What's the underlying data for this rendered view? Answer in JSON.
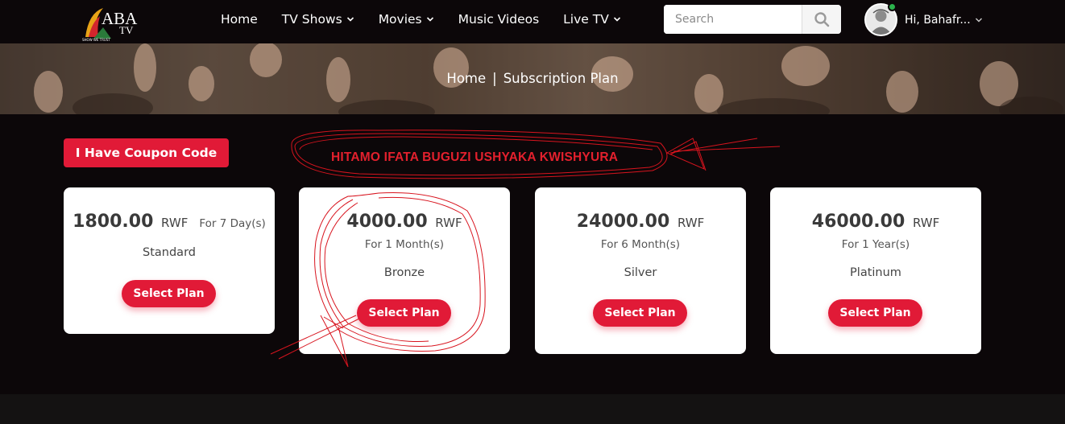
{
  "header": {
    "logo": {
      "wordmark": "ABA",
      "sub": "TV",
      "tagline": "SHOW WE TRUST"
    },
    "nav": [
      {
        "label": "Home",
        "dropdown": false
      },
      {
        "label": "TV Shows",
        "dropdown": true
      },
      {
        "label": "Movies",
        "dropdown": true
      },
      {
        "label": "Music Videos",
        "dropdown": false
      },
      {
        "label": "Live TV",
        "dropdown": true
      }
    ],
    "search": {
      "placeholder": "Search",
      "value": ""
    },
    "user": {
      "greeting": "Hi, Bahafr..."
    }
  },
  "banner": {
    "breadcrumb": {
      "home": "Home",
      "separator": "|",
      "current": "Subscription Plan"
    }
  },
  "main": {
    "coupon_label": "I Have Coupon Code",
    "annotation": "HITAMO IFATA BUGUZI USHYAKA KWISHYURA",
    "plans": [
      {
        "price": "1800.00",
        "currency": "RWF",
        "duration": "For 7 Day(s)",
        "tier": "Standard",
        "button": "Select Plan"
      },
      {
        "price": "4000.00",
        "currency": "RWF",
        "duration": "For 1 Month(s)",
        "tier": "Bronze",
        "button": "Select Plan"
      },
      {
        "price": "24000.00",
        "currency": "RWF",
        "duration": "For 6 Month(s)",
        "tier": "Silver",
        "button": "Select Plan"
      },
      {
        "price": "46000.00",
        "currency": "RWF",
        "duration": "For 1 Year(s)",
        "tier": "Platinum",
        "button": "Select Plan"
      }
    ]
  },
  "colors": {
    "accent": "#e11a37",
    "background": "#0c0709",
    "annotation": "#e3202d",
    "online": "#2bb24c"
  },
  "icons": [
    "logo",
    "chevron-down-icon",
    "search-icon",
    "avatar",
    "online-status-icon"
  ]
}
